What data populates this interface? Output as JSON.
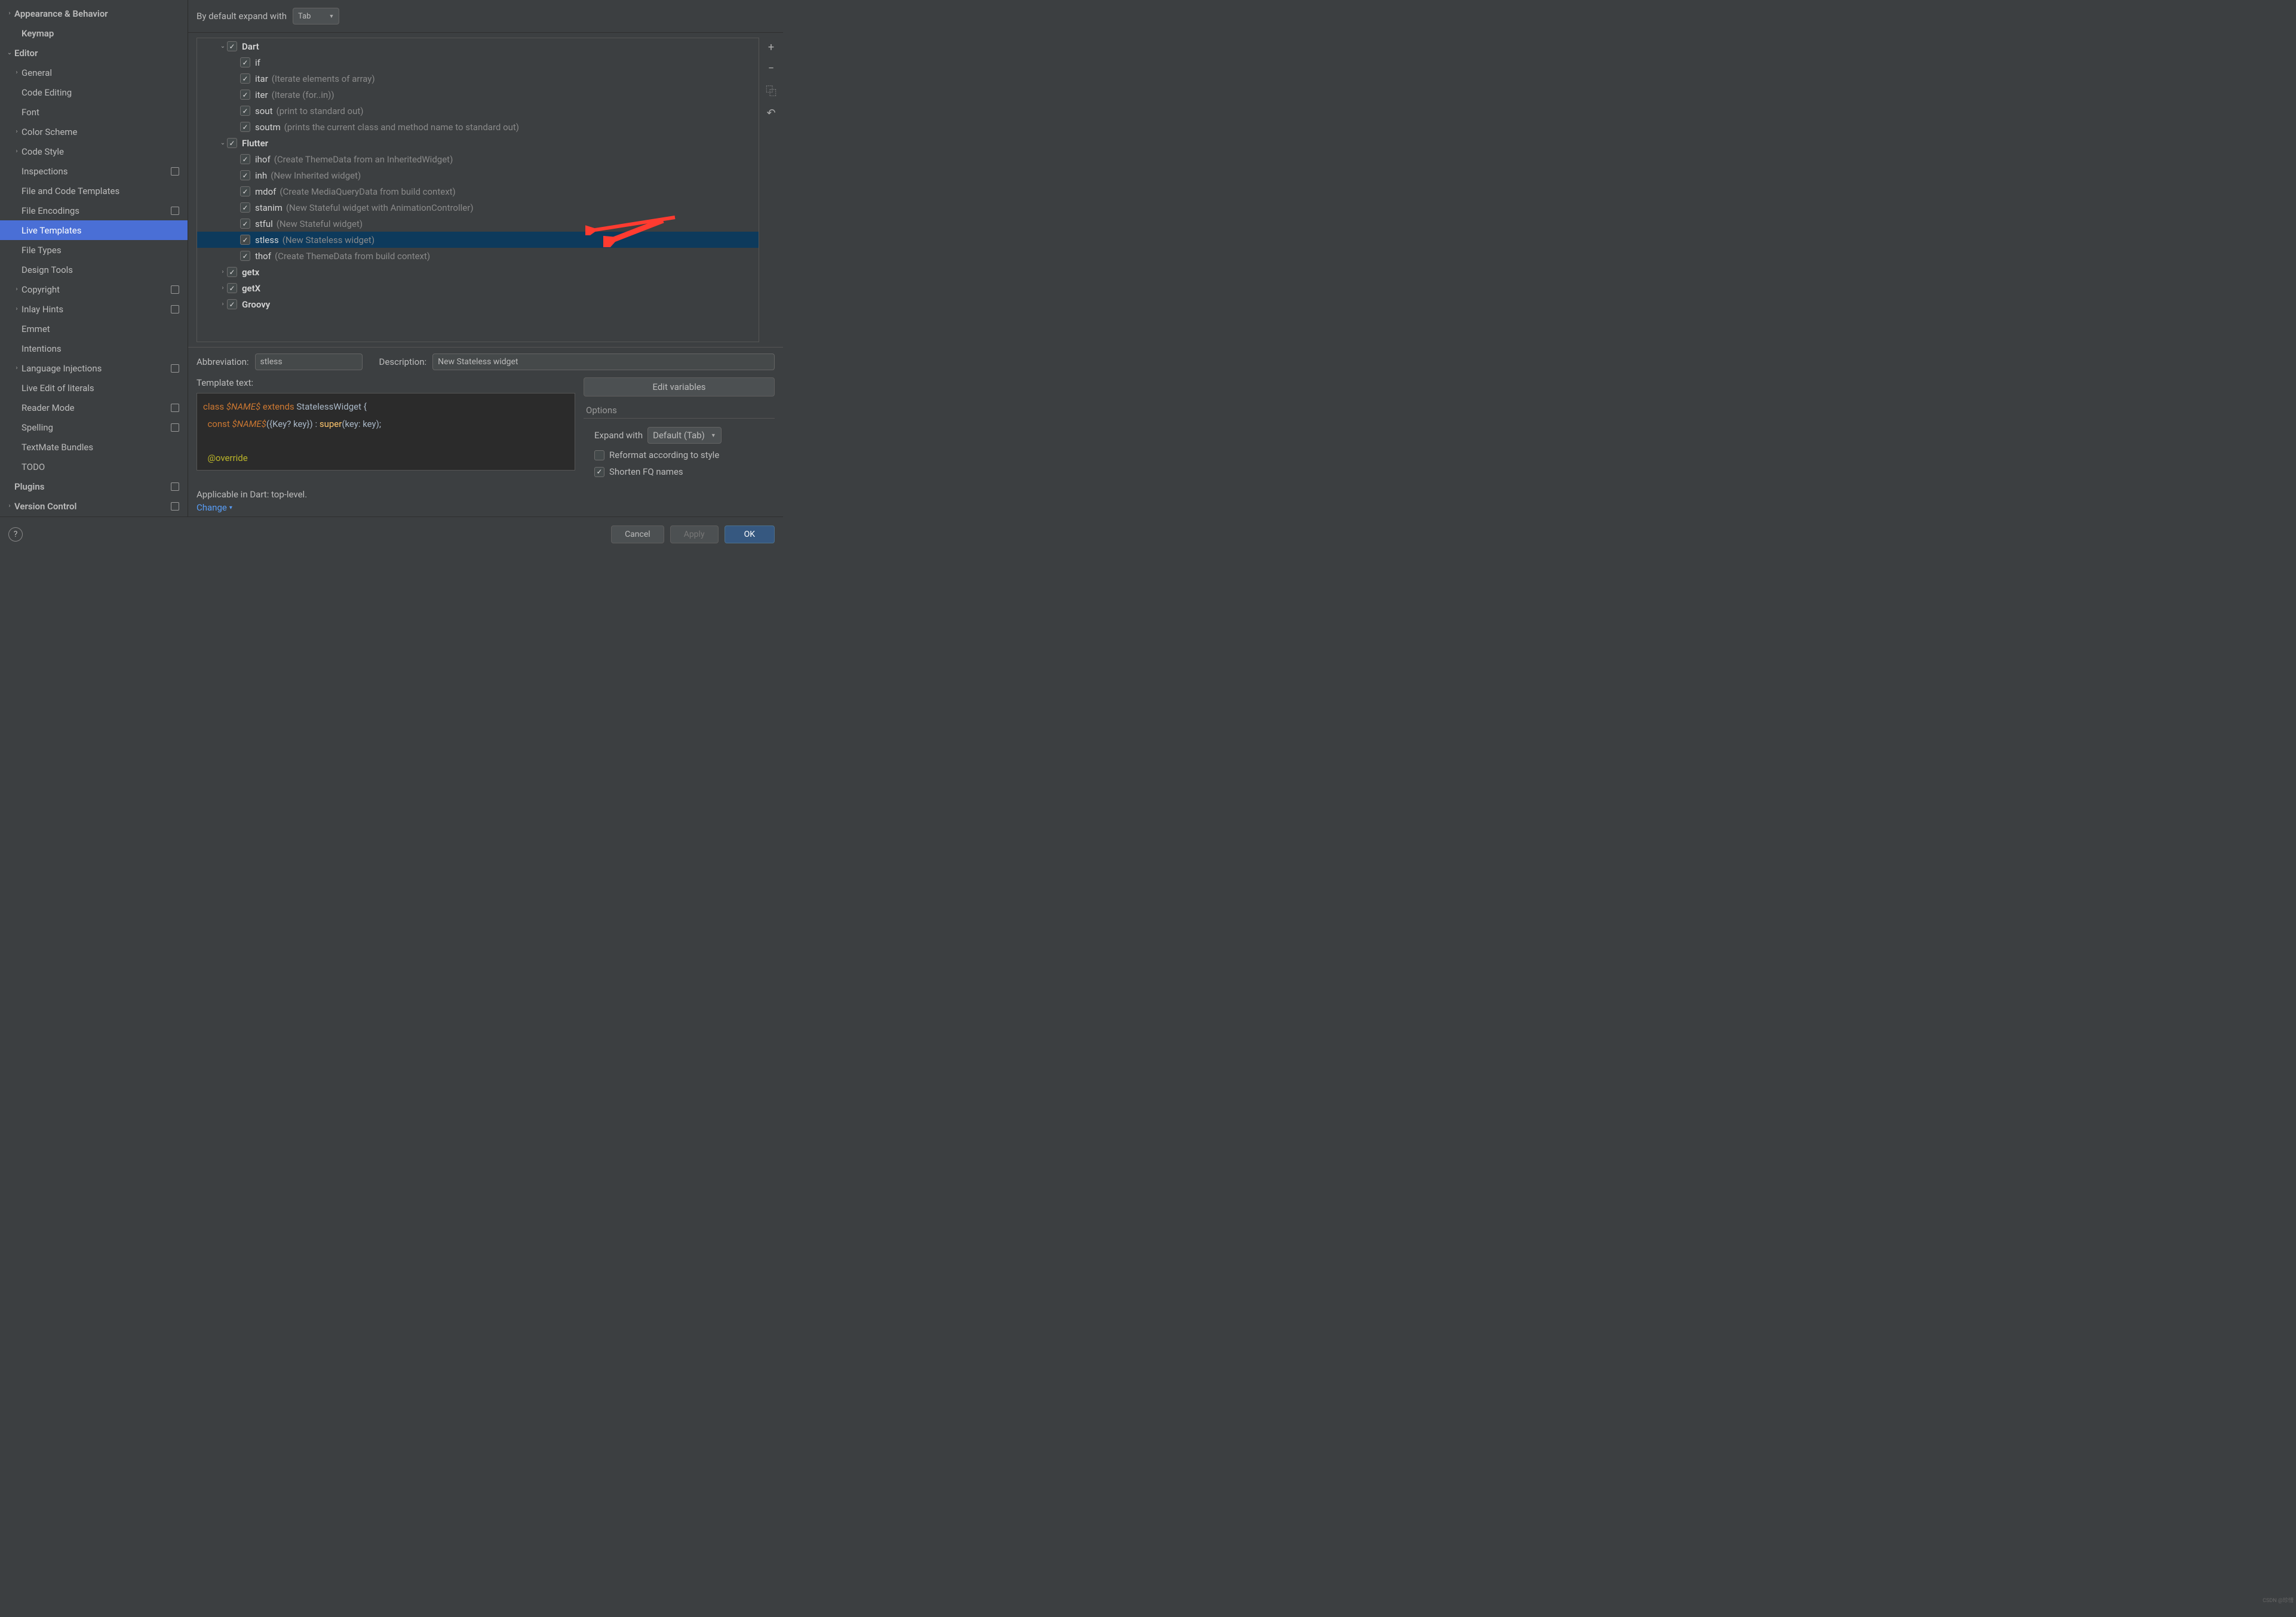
{
  "sidebar": {
    "items": [
      {
        "label": "Appearance & Behavior",
        "chev": ">",
        "indent": 0,
        "bold": true
      },
      {
        "label": "Keymap",
        "chev": "",
        "indent": 1,
        "bold": true
      },
      {
        "label": "Editor",
        "chev": "v",
        "indent": 0,
        "bold": true
      },
      {
        "label": "General",
        "chev": ">",
        "indent": 1
      },
      {
        "label": "Code Editing",
        "chev": "",
        "indent": 1
      },
      {
        "label": "Font",
        "chev": "",
        "indent": 1
      },
      {
        "label": "Color Scheme",
        "chev": ">",
        "indent": 1
      },
      {
        "label": "Code Style",
        "chev": ">",
        "indent": 1
      },
      {
        "label": "Inspections",
        "chev": "",
        "indent": 1,
        "badge": true
      },
      {
        "label": "File and Code Templates",
        "chev": "",
        "indent": 1
      },
      {
        "label": "File Encodings",
        "chev": "",
        "indent": 1,
        "badge": true
      },
      {
        "label": "Live Templates",
        "chev": "",
        "indent": 1,
        "selected": true
      },
      {
        "label": "File Types",
        "chev": "",
        "indent": 1
      },
      {
        "label": "Design Tools",
        "chev": "",
        "indent": 1
      },
      {
        "label": "Copyright",
        "chev": ">",
        "indent": 1,
        "badge": true
      },
      {
        "label": "Inlay Hints",
        "chev": ">",
        "indent": 1,
        "badge": true
      },
      {
        "label": "Emmet",
        "chev": "",
        "indent": 1
      },
      {
        "label": "Intentions",
        "chev": "",
        "indent": 1
      },
      {
        "label": "Language Injections",
        "chev": ">",
        "indent": 1,
        "badge": true
      },
      {
        "label": "Live Edit of literals",
        "chev": "",
        "indent": 1
      },
      {
        "label": "Reader Mode",
        "chev": "",
        "indent": 1,
        "badge": true
      },
      {
        "label": "Spelling",
        "chev": "",
        "indent": 1,
        "badge": true
      },
      {
        "label": "TextMate Bundles",
        "chev": "",
        "indent": 1
      },
      {
        "label": "TODO",
        "chev": "",
        "indent": 1
      },
      {
        "label": "Plugins",
        "chev": "",
        "indent": 0,
        "bold": true,
        "badge": true
      },
      {
        "label": "Version Control",
        "chev": ">",
        "indent": 0,
        "bold": true,
        "badge": true
      }
    ]
  },
  "top": {
    "expand_label": "By default expand with",
    "expand_value": "Tab"
  },
  "tree": {
    "rows": [
      {
        "chv": "v",
        "cbx": true,
        "name": "Dart",
        "bold": true,
        "pad": 1
      },
      {
        "cbx": true,
        "name": "if",
        "pad": 2
      },
      {
        "cbx": true,
        "name": "itar",
        "desc": "(Iterate elements of array)",
        "pad": 2
      },
      {
        "cbx": true,
        "name": "iter",
        "desc": "(Iterate (for..in))",
        "pad": 2
      },
      {
        "cbx": true,
        "name": "sout",
        "desc": "(print to standard out)",
        "pad": 2
      },
      {
        "cbx": true,
        "name": "soutm",
        "desc": "(prints the current class and method name to standard out)",
        "pad": 2
      },
      {
        "chv": "v",
        "cbx": true,
        "name": "Flutter",
        "bold": true,
        "pad": 1
      },
      {
        "cbx": true,
        "name": "ihof",
        "desc": "(Create ThemeData from an InheritedWidget)",
        "pad": 2
      },
      {
        "cbx": true,
        "name": "inh",
        "desc": "(New Inherited widget)",
        "pad": 2
      },
      {
        "cbx": true,
        "name": "mdof",
        "desc": "(Create MediaQueryData from build context)",
        "pad": 2
      },
      {
        "cbx": true,
        "name": "stanim",
        "desc": "(New Stateful widget with AnimationController)",
        "pad": 2
      },
      {
        "cbx": true,
        "name": "stful",
        "desc": "(New Stateful widget)",
        "pad": 2
      },
      {
        "cbx": true,
        "name": "stless",
        "desc": "(New Stateless widget)",
        "pad": 2,
        "sel": true
      },
      {
        "cbx": true,
        "name": "thof",
        "desc": "(Create ThemeData from build context)",
        "pad": 2
      },
      {
        "chv": ">",
        "cbx": true,
        "name": "getx",
        "bold": true,
        "pad": 1
      },
      {
        "chv": ">",
        "cbx": true,
        "name": "getX",
        "bold": true,
        "pad": 1
      },
      {
        "chv": ">",
        "cbx": true,
        "name": "Groovy",
        "bold": true,
        "pad": 1
      }
    ]
  },
  "toolbar": {
    "add": "+",
    "remove": "−",
    "copy": "⿻",
    "revert": "↶"
  },
  "detail": {
    "abbr_label": "Abbreviation:",
    "abbr_value": "stless",
    "desc_label": "Description:",
    "desc_value": "New Stateless widget",
    "tt_label": "Template text:",
    "code_l1_kw": "class ",
    "code_l1_var": "$NAME$",
    "code_l1_kw2": " extends ",
    "code_l1_id": "StatelessWidget {",
    "code_l2a": "  ",
    "code_l2_kw": "const ",
    "code_l2_var": "$NAME$",
    "code_l2_id1": "({Key? key}) : ",
    "code_l2_fn": "super",
    "code_l2_id2": "(key: key);",
    "code_l4": "  @override",
    "edit_vars": "Edit variables",
    "options_title": "Options",
    "expand_with_label": "Expand with",
    "expand_with_value": "Default (Tab)",
    "reformat_label": "Reformat according to style",
    "shorten_label": "Shorten FQ names"
  },
  "applic": {
    "text": "Applicable in Dart: top-level.",
    "change": "Change"
  },
  "footer": {
    "cancel": "Cancel",
    "apply": "Apply",
    "ok": "OK"
  },
  "watermark": "CSDN @珍惜"
}
